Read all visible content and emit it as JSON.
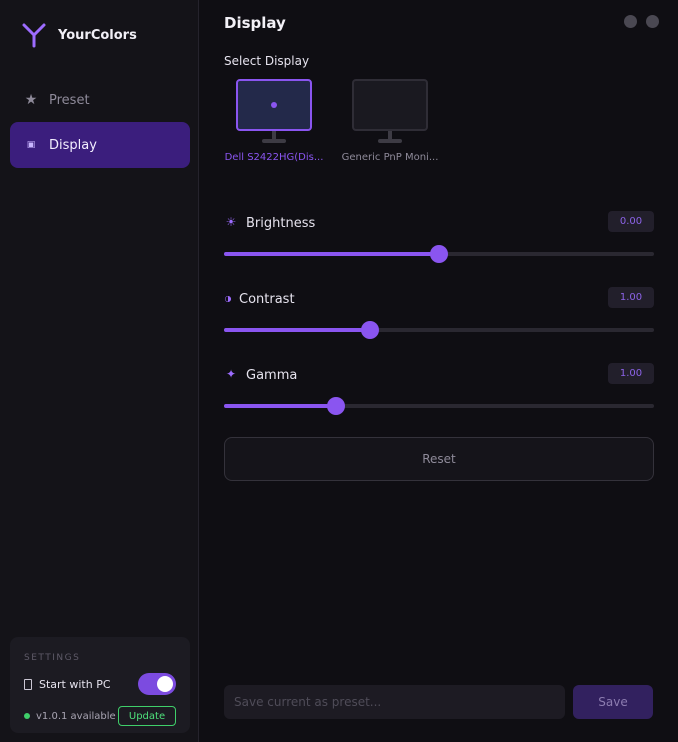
{
  "app": {
    "name": "YourColors",
    "accent": "#8a55f0"
  },
  "sidebar": {
    "items": [
      {
        "label": "Preset",
        "icon": "star-icon",
        "active": false
      },
      {
        "label": "Display",
        "icon": "display-dot-icon",
        "active": true
      }
    ],
    "settings": {
      "title": "SETTINGS",
      "startup_label": "Start with PC",
      "startup_enabled": true,
      "version_label": "v1.0.1 available",
      "update_label": "Update"
    }
  },
  "page": {
    "title": "Display"
  },
  "display_select": {
    "label": "Select Display",
    "monitors": [
      {
        "name": "Dell S2422HG(Dis...",
        "selected": true
      },
      {
        "name": "Generic PnP Moni...",
        "selected": false
      }
    ]
  },
  "sliders": [
    {
      "label": "Brightness",
      "icon": "sun-icon",
      "value": "0.00",
      "position": 0.5
    },
    {
      "label": "Contrast",
      "icon": "contrast-icon",
      "value": "1.00",
      "position": 0.34
    },
    {
      "label": "Gamma",
      "icon": "sparkle-icon",
      "value": "1.00",
      "position": 0.26
    }
  ],
  "actions": {
    "reset_label": "Reset",
    "preset_placeholder": "Save current as preset...",
    "save_label": "Save"
  }
}
